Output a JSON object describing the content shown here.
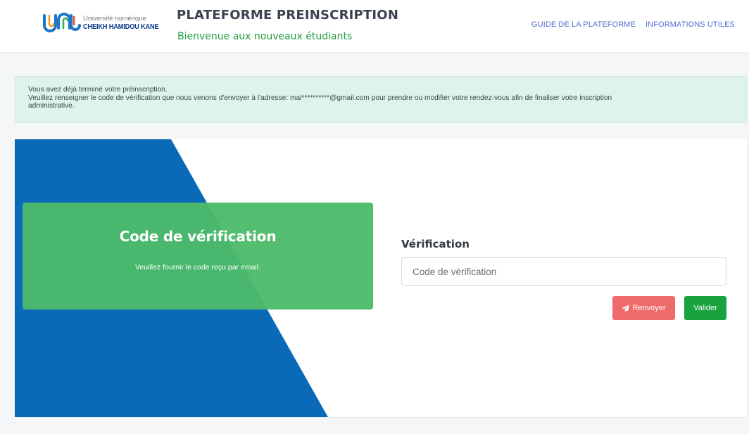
{
  "header": {
    "logo": {
      "line1": "Université numérique",
      "line2": "CHEIKH HAMIDOU KANE"
    },
    "title": "PLATEFORME PREINSCRIPTION",
    "subtitle": "Bienvenue aux nouveaux étudiants",
    "nav": [
      {
        "label": "GUIDE DE LA PLATEFORME"
      },
      {
        "label": "INFORMATIONS UTILES"
      }
    ]
  },
  "alert": {
    "line1": "Vous avez déjà terminé votre préinscription.",
    "line2": "Veuillez renseigner le code de vérification que nous venons d'envoyer à l'adresse: mai**********@gmail.com pour prendre ou modifier votre rendez-vous afin de finaliser votre inscription",
    "line3": "administrative."
  },
  "card": {
    "box_title": "Code de vérification",
    "box_subtitle": "Veuillez fournir le code reçu par email.",
    "form_label": "Vérification",
    "input_placeholder": "Code de vérification",
    "input_value": "",
    "resend_label": "Renvoyer",
    "resend_icon": "paper-plane-icon",
    "validate_label": "Valider"
  },
  "colors": {
    "blue": "#0b6ab8",
    "green_box": "#4cba6a",
    "green_text": "#1e9e3e",
    "alert_bg": "#dff3ec",
    "resend": "#ef6b6b",
    "validate": "#18a33f",
    "nav_link": "#5a6ad1"
  }
}
